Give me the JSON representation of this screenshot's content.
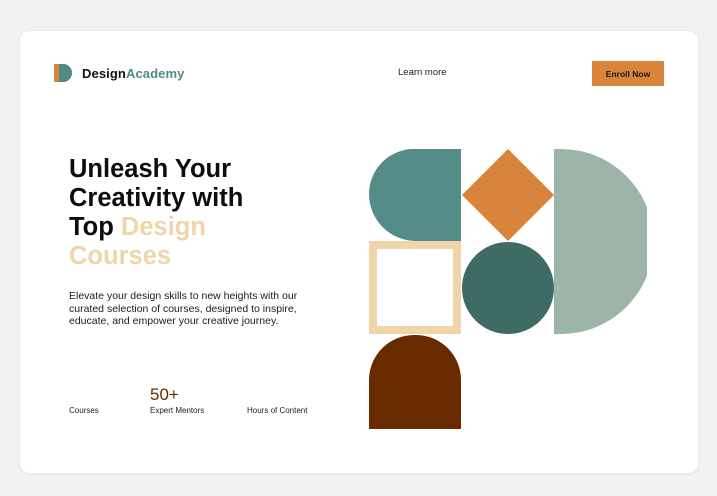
{
  "brand": {
    "name_part1": "Design",
    "name_part2": "Academy"
  },
  "nav": {
    "learn_more": "Learn more",
    "enroll_label": "Enroll Now"
  },
  "hero": {
    "line1": "Unleash Your",
    "line2": "Creativity with",
    "line3_plain": "Top ",
    "line3_accent": "Design",
    "line4_accent": "Courses",
    "description": "Elevate your design skills to new heights with our curated selection of courses, designed to inspire, educate, and empower your creative journey."
  },
  "stats": [
    {
      "value": "",
      "label": "Courses"
    },
    {
      "value": "50+",
      "label": "Expert Mentors"
    },
    {
      "value": "",
      "label": "Hours of Content"
    }
  ],
  "colors": {
    "background": "#f2f2f2",
    "card": "#ffffff",
    "teal": "#558c87",
    "orange": "#d9843b",
    "sage": "#9cb5a8",
    "sand": "#efd5a8",
    "dark_teal": "#3f6b65",
    "brown": "#6a2a00",
    "brand_accent": "#4f8a86"
  },
  "icons": {
    "logo": "two-tone-d-logo-icon"
  }
}
